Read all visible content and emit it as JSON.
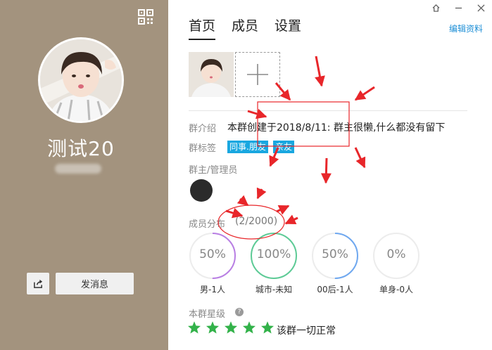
{
  "profile": {
    "group_name": "测试20",
    "send_label": "发消息",
    "qr_icon": "qr-code-icon",
    "share_icon": "share-icon"
  },
  "tabs": [
    {
      "label": "首页",
      "active": true
    },
    {
      "label": "成员",
      "active": false
    },
    {
      "label": "设置",
      "active": false
    }
  ],
  "edit_label": "编辑资料",
  "window_controls": [
    "pin-icon",
    "minimize-icon",
    "close-icon"
  ],
  "intro": {
    "label": "群介绍",
    "text": "本群创建于2018/8/11:  群主很懒,什么都没有留下"
  },
  "tags": {
    "label": "群标签",
    "items": [
      "同事.朋友",
      "亲友"
    ]
  },
  "admin": {
    "label": "群主/管理员"
  },
  "distribution": {
    "label": "成员分布",
    "count": "(2/2000)",
    "rings": [
      {
        "value": "50%",
        "caption": "男-1人",
        "fraction": 0.5,
        "color": "#b97fe4"
      },
      {
        "value": "100%",
        "caption": "城市-未知",
        "fraction": 1.0,
        "color": "#5dcb96"
      },
      {
        "value": "50%",
        "caption": "00后-1人",
        "fraction": 0.5,
        "color": "#6fa8f0"
      },
      {
        "value": "0%",
        "caption": "单身-0人",
        "fraction": 0.0,
        "color": "#f08080"
      }
    ]
  },
  "stars": {
    "label": "本群星级",
    "help": "?",
    "count": 5,
    "status": "该群一切正常",
    "color": "#33b24a"
  },
  "colors": {
    "panel": "#a3937e",
    "tag": "#19a7e0",
    "link": "#1e8fd6",
    "annotation": "#e8262a"
  }
}
